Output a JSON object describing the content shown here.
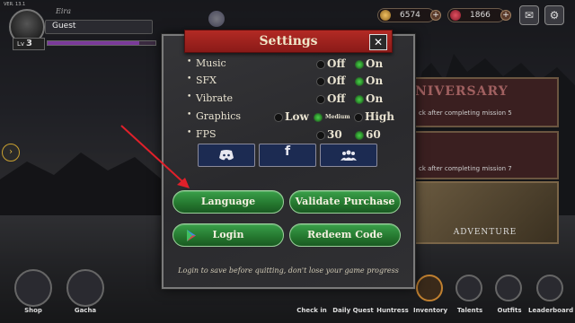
{
  "version": "VER. 13.1",
  "player": {
    "character": "Eira",
    "name": "Guest",
    "level_prefix": "Lv",
    "level": "3",
    "xp_fraction": 0.85
  },
  "currency": {
    "gold": "6574",
    "gems": "1866"
  },
  "colors": {
    "banner": "#b22a24",
    "green_button": "#2a8a34",
    "radio_on": "#4ad04a",
    "social_bg": "#1c2b52",
    "annotation_arrow": "#e0202a"
  },
  "cards": {
    "anniversary_title": "NIVERSARY",
    "card1_text": "ck after completing mission 5",
    "card2_text": "ck after completing mission 7",
    "adventure": "ADVENTURE"
  },
  "nav": {
    "shop": "Shop",
    "gacha": "Gacha",
    "checkin": "Check in",
    "daily": "Daily Quest",
    "huntress": "Huntress",
    "inventory": "Inventory",
    "talents": "Talents",
    "outfits": "Outfits",
    "leaderboard": "Leaderboard"
  },
  "settings": {
    "title": "Settings",
    "close": "✕",
    "options": {
      "music": {
        "label": "Music",
        "off": "Off",
        "on": "On",
        "selected": "On"
      },
      "sfx": {
        "label": "SFX",
        "off": "Off",
        "on": "On",
        "selected": "On"
      },
      "vibrate": {
        "label": "Vibrate",
        "off": "Off",
        "on": "On",
        "selected": "On"
      },
      "graphics": {
        "label": "Graphics",
        "low": "Low",
        "medium": "Medium",
        "high": "High",
        "selected": "Medium"
      },
      "fps": {
        "label": "FPS",
        "v30": "30",
        "v60": "60",
        "selected": "60"
      }
    },
    "social": {
      "discord_icon": "discord-icon",
      "facebook": "f",
      "community_icon": "people-icon"
    },
    "buttons": {
      "language": "Language",
      "validate": "Validate Purchase",
      "login": "Login",
      "redeem": "Redeem Code"
    },
    "footer": "Login to save before quitting, don't lose your game progress"
  }
}
